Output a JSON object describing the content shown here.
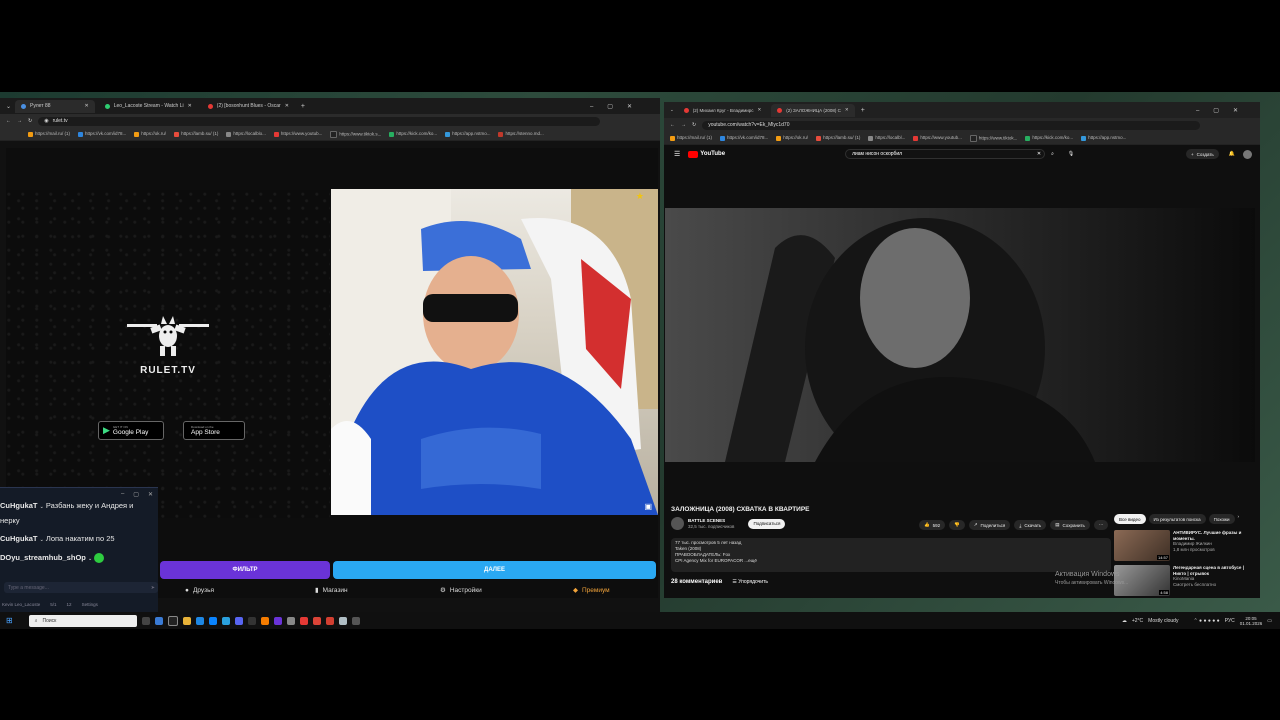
{
  "left_browser": {
    "tabs": [
      {
        "label": "Рулет 88",
        "color": "#4a90e2"
      },
      {
        "label": "Leo_Lacoste Stream - Watch Li",
        "color": "#2ecc71"
      },
      {
        "label": "(2) [bosonhunt Blues - Oscar",
        "color": "#e53935"
      }
    ],
    "url": "rulet.tv",
    "bookmarks": [
      "https://mail.ru/ (1)",
      "https://vk.com/id78...",
      "https://ok.ru/",
      "https://lamb.su/ (1)",
      "https://localblo...",
      "https://www.youtub...",
      "https://www.tiktok.s...",
      "https://kick.com/ko...",
      "https://app.nstmo...",
      "https://stenno.md..."
    ]
  },
  "rulet": {
    "logo_text": "RULET.TV",
    "google_play": {
      "small": "GET IT ON",
      "label": "Google Play"
    },
    "app_store": {
      "small": "Download on the",
      "label": "App Store"
    },
    "btn_left": "ФИЛЬТР",
    "btn_right": "ДАЛЕЕ",
    "nav": [
      "Друзья",
      "Магазин",
      "Настройки",
      "Премиум"
    ]
  },
  "chat": {
    "messages": [
      {
        "user": "CuHgukaT",
        "text": "Разбань жеку и Андрея и"
      },
      {
        "user": "",
        "text": "нерку"
      },
      {
        "user": "CuHgukaT",
        "text": "Лопа накатим по 25"
      },
      {
        "user": "DOyu_streamhub_shOp",
        "text": ""
      }
    ],
    "input_placeholder": "Type a message...",
    "footer_user": "Kevin Leo_Lacoste",
    "footer_count1": "5/1",
    "footer_count2": "12",
    "footer_action": "Settings"
  },
  "right_browser": {
    "tabs": [
      {
        "label": "(2) Михаил Круг - Владимирс",
        "color": "#e53935"
      },
      {
        "label": "(2) ЗАЛОЖНИЦА (2008) С",
        "color": "#e53935"
      }
    ],
    "url": "youtube.com/watch?v=Ek_Mlyc1d70",
    "bookmarks": [
      "https://mail.ru/ (1)",
      "https://vk.com/id78...",
      "https://ok.ru/",
      "https://lamb.su/ (1)",
      "https://localbl...",
      "https://www.youtub...",
      "https://www.tiktok...",
      "https://kick.com/ko...",
      "https://app.nstmo..."
    ]
  },
  "youtube": {
    "logo": "YouTube",
    "search_value": "лиам нисон оскорбил",
    "create_label": "Создать",
    "video_title": "ЗАЛОЖНИЦА (2008) СХВАТКА В КВАРТИРЕ",
    "channel": "BATTLE SCENES",
    "subs": "32,5 тыс. подписчиков",
    "subscribe": "Подписаться",
    "likes": "592",
    "share": "Поделиться",
    "download": "Скачать",
    "save": "Сохранить",
    "desc_lines": [
      "77 тыс. просмотров  5 лет назад",
      "Taken (2008)",
      "ПРАВООБЛАДАТЕЛЬ: Fox",
      "CPI Agency Mix for EUROPACOR ...ещё"
    ],
    "comments": "28 комментариев",
    "sort": "Упорядочить",
    "chips": [
      "Все видео",
      "Из результатов поиска",
      "Похожи"
    ],
    "recs": [
      {
        "title": "АНТИВИРУС. Лучшие фразы и моменты.",
        "channel": "Владимир Жилкин",
        "meta": "1,8 млн просмотров",
        "duration": "14:57"
      },
      {
        "title": "Легендарная сцена в автобусе | Никто | отрывок",
        "channel": "KinoMania",
        "meta": "Смотреть бесплатно",
        "duration": "4:58"
      }
    ],
    "activation1": "Активация Windows",
    "activation2": "Чтобы активировать Windows..."
  },
  "taskbar": {
    "search": "Поиск",
    "weather": "+2°C",
    "weather_text": "Mostly cloudy",
    "lang": "РУС",
    "time": "20:05",
    "date": "01.01.2026"
  }
}
